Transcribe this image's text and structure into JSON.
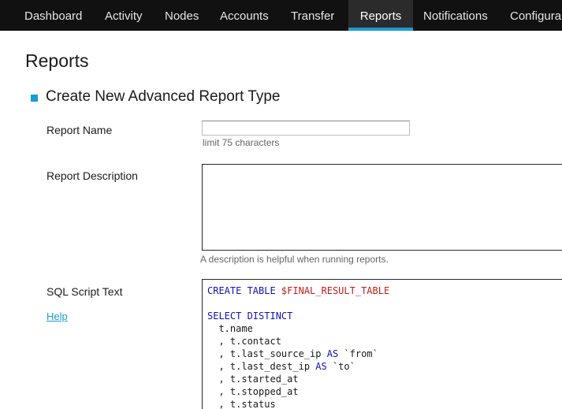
{
  "nav": {
    "tabs": [
      {
        "label": "Dashboard"
      },
      {
        "label": "Activity"
      },
      {
        "label": "Nodes"
      },
      {
        "label": "Accounts"
      },
      {
        "label": "Transfer"
      },
      {
        "label": "Reports",
        "active": true
      },
      {
        "label": "Notifications"
      },
      {
        "label": "Configura"
      }
    ],
    "accent_color": "#1b9bd7"
  },
  "page": {
    "title": "Reports"
  },
  "section": {
    "title": "Create New Advanced Report Type"
  },
  "form": {
    "report_name": {
      "label": "Report Name",
      "value": "",
      "hint": "limit 75 characters"
    },
    "report_description": {
      "label": "Report Description",
      "value": "",
      "hint": "A description is helpful when running reports."
    },
    "sql_script": {
      "label": "SQL Script Text",
      "help_label": "Help",
      "lines": [
        [
          {
            "t": "CREATE TABLE ",
            "c": "kw"
          },
          {
            "t": "$FINAL_RESULT_TABLE",
            "c": "var"
          }
        ],
        [],
        [
          {
            "t": "SELECT DISTINCT",
            "c": "kw"
          }
        ],
        [
          {
            "t": "  t.name",
            "c": "plain"
          }
        ],
        [
          {
            "t": "  , t.contact",
            "c": "plain"
          }
        ],
        [
          {
            "t": "  , t.last_source_ip ",
            "c": "plain"
          },
          {
            "t": "AS",
            "c": "kw"
          },
          {
            "t": " `from`",
            "c": "plain"
          }
        ],
        [
          {
            "t": "  , t.last_dest_ip ",
            "c": "plain"
          },
          {
            "t": "AS",
            "c": "kw"
          },
          {
            "t": " `to`",
            "c": "plain"
          }
        ],
        [
          {
            "t": "  , t.started_at",
            "c": "plain"
          }
        ],
        [
          {
            "t": "  , t.stopped_at",
            "c": "plain"
          }
        ],
        [
          {
            "t": "  , t.status",
            "c": "plain"
          }
        ]
      ]
    }
  }
}
